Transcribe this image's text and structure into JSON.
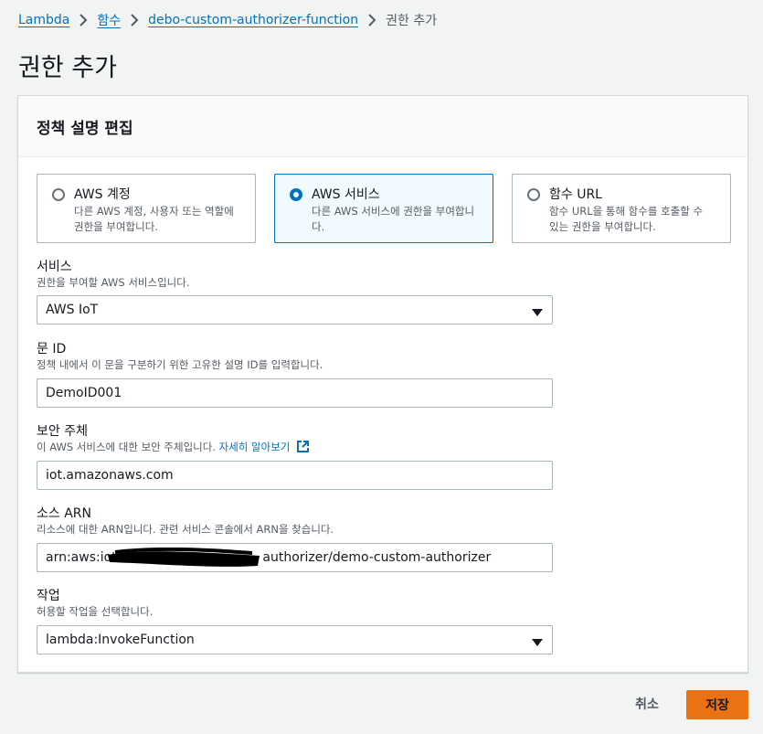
{
  "breadcrumb": {
    "items": [
      "Lambda",
      "함수",
      "debo-custom-authorizer-function"
    ],
    "current": "권한 추가"
  },
  "page": {
    "title": "권한 추가"
  },
  "panel": {
    "title": "정책 설명 편집"
  },
  "tiles": [
    {
      "title": "AWS 계정",
      "desc_line1": "다른 AWS 계정, 사용자 또는 역할에",
      "desc_line2": "권한을 부여합니다.",
      "selected": false
    },
    {
      "title": "AWS 서비스",
      "desc_line1": "다른 AWS 서비스에 권한을 부여합니",
      "desc_line2": "다.",
      "selected": true
    },
    {
      "title": "함수 URL",
      "desc_line1": "함수 URL을 통해 함수를 호출할 수",
      "desc_line2": "있는 권한을 부여합니다.",
      "selected": false
    }
  ],
  "fields": {
    "service": {
      "label": "서비스",
      "desc": "권한을 부여할 AWS 서비스입니다.",
      "value": "AWS IoT"
    },
    "statement_id": {
      "label": "문 ID",
      "desc": "정책 내에서 이 문을 구분하기 위한 고유한 설명 ID를 입력합니다.",
      "value": "DemoID001"
    },
    "principal": {
      "label": "보안 주체",
      "desc": "이 AWS 서비스에 대한 보안 주체입니다.",
      "link": "자세히 알아보기",
      "value": "iot.amazonaws.com"
    },
    "source_arn": {
      "label": "소스 ARN",
      "desc": "리소스에 대한 ARN입니다. 관련 서비스 콘솔에서 ARN을 찾습니다.",
      "value_prefix": "arn:aws:iot:",
      "value_suffix": "authorizer/demo-custom-authorizer"
    },
    "action": {
      "label": "작업",
      "desc": "허용할 작업을 선택합니다.",
      "value": "lambda:InvokeFunction"
    }
  },
  "footer": {
    "cancel_label": "취소",
    "save_label": "저장"
  },
  "colors": {
    "link": "#0073bb",
    "primary": "#ec7211",
    "selected_border": "#0073bb"
  },
  "icons": {
    "breadcrumb_separator": "chevron-right-icon",
    "dropdown": "caret-down-icon",
    "external": "external-link-icon"
  }
}
